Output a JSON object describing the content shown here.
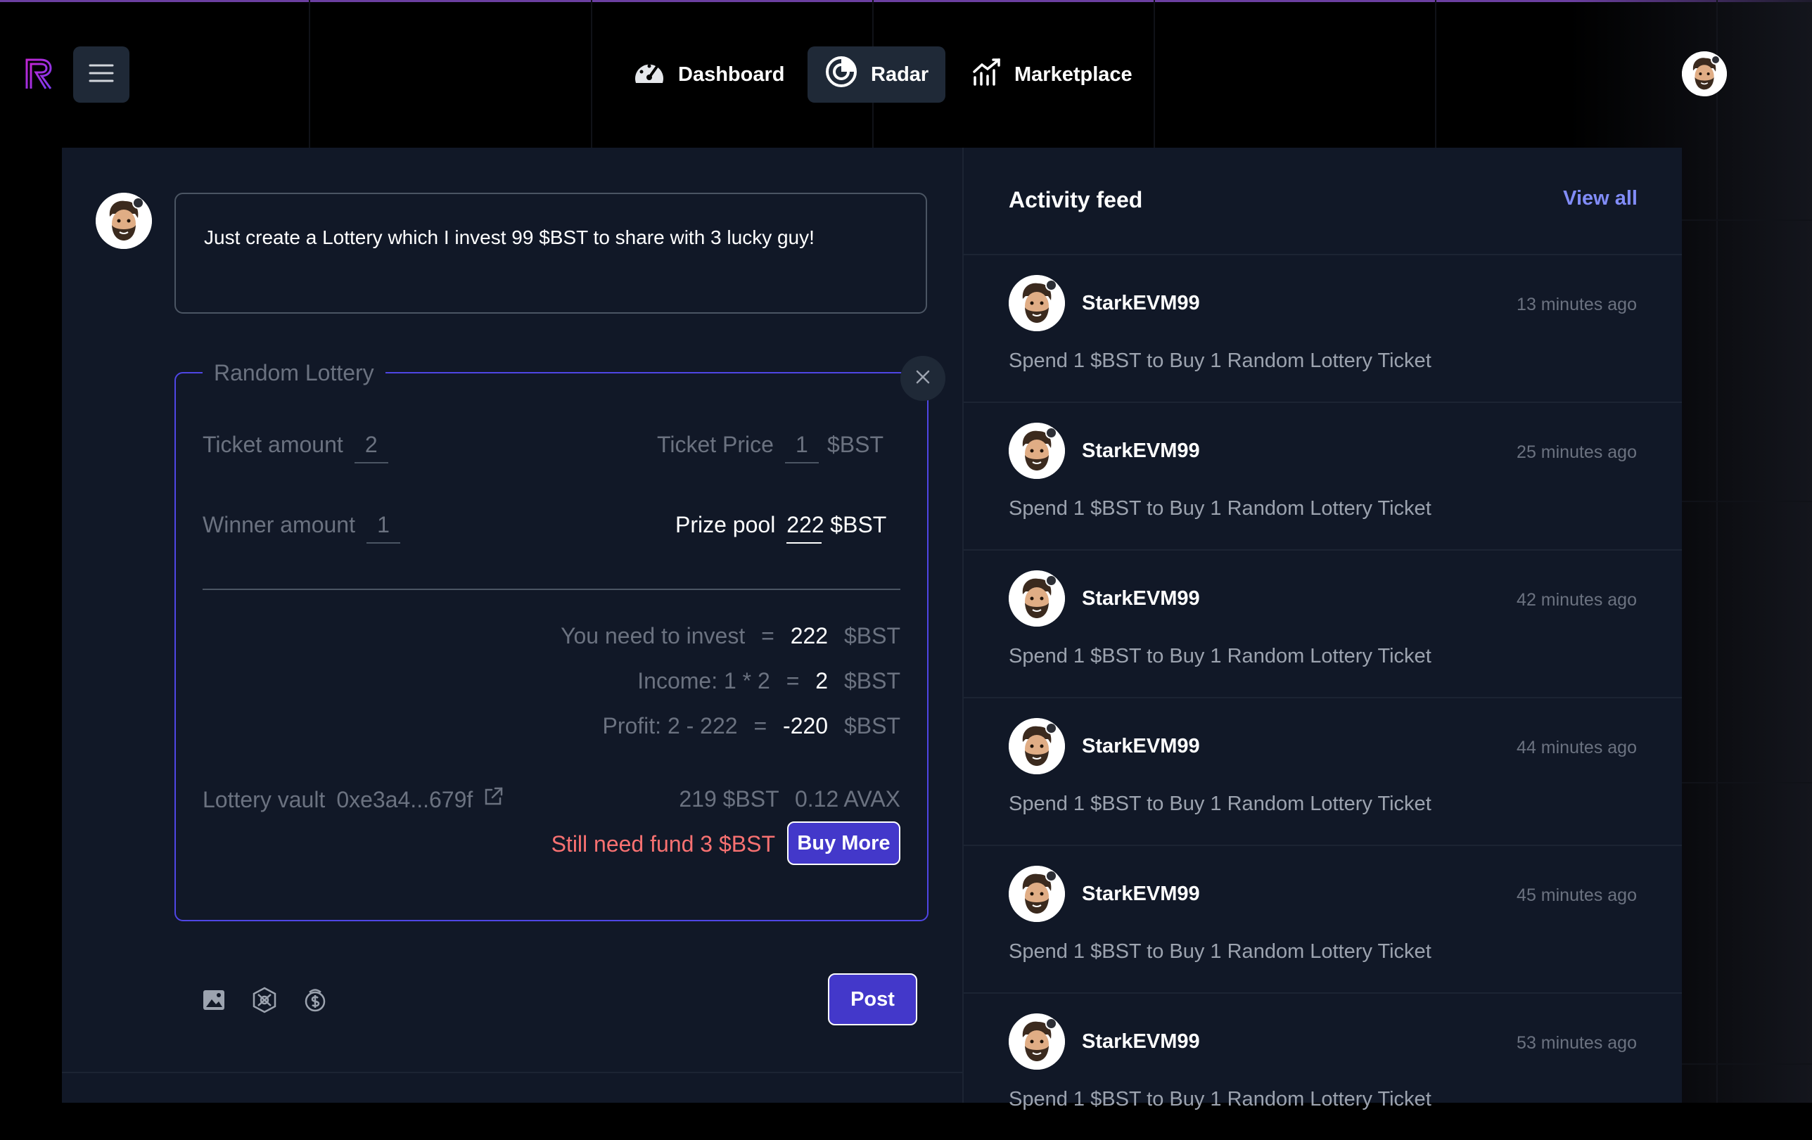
{
  "header": {
    "nav": [
      {
        "label": "Dashboard",
        "icon": "dashboard-gauge-icon"
      },
      {
        "label": "Radar",
        "icon": "radar-icon",
        "active": true
      },
      {
        "label": "Marketplace",
        "icon": "chart-bars-icon"
      }
    ]
  },
  "composer": {
    "text": "Just create a Lottery which I invest 99 $BST to share with 3 lucky guy!",
    "post_label": "Post",
    "tools": [
      "image-icon",
      "nft-icon",
      "dollar-coin-icon"
    ]
  },
  "lottery": {
    "legend": "Random Lottery",
    "ticket_amount_label": "Ticket amount",
    "ticket_amount": "2",
    "ticket_price_label": "Ticket Price",
    "ticket_price": "1",
    "currency": "$BST",
    "winner_amount_label": "Winner amount",
    "winner_amount": "1",
    "prize_pool_label": "Prize pool",
    "prize_pool": "222",
    "invest_label": "You need to invest",
    "invest_eq": "=",
    "invest_value": "222",
    "income_label": "Income: 1 * 2",
    "income_eq": "=",
    "income_value": "2",
    "profit_label": "Profit: 2 - 222",
    "profit_eq": "=",
    "profit_value": "-220",
    "vault_label": "Lottery vault",
    "vault_address": "0xe3a4...679f",
    "vault_bst": "219 $BST",
    "vault_avax": "0.12 AVAX",
    "need_fund": "Still need fund 3 $BST",
    "buy_more": "Buy More"
  },
  "feed": {
    "title": "Activity feed",
    "view_all": "View all",
    "items": [
      {
        "user": "StarkEVM99",
        "time": "13 minutes ago",
        "text": "Spend 1 $BST to Buy 1 Random Lottery Ticket"
      },
      {
        "user": "StarkEVM99",
        "time": "25 minutes ago",
        "text": "Spend 1 $BST to Buy 1 Random Lottery Ticket"
      },
      {
        "user": "StarkEVM99",
        "time": "42 minutes ago",
        "text": "Spend 1 $BST to Buy 1 Random Lottery Ticket"
      },
      {
        "user": "StarkEVM99",
        "time": "44 minutes ago",
        "text": "Spend 1 $BST to Buy 1 Random Lottery Ticket"
      },
      {
        "user": "StarkEVM99",
        "time": "45 minutes ago",
        "text": "Spend 1 $BST to Buy 1 Random Lottery Ticket"
      },
      {
        "user": "StarkEVM99",
        "time": "53 minutes ago",
        "text": "Spend 1 $BST to Buy 1 Random Lottery Ticket"
      }
    ]
  },
  "colors": {
    "accent": "#4338ca",
    "panel": "#111827",
    "warning": "#f87171",
    "link": "#818cf8"
  }
}
